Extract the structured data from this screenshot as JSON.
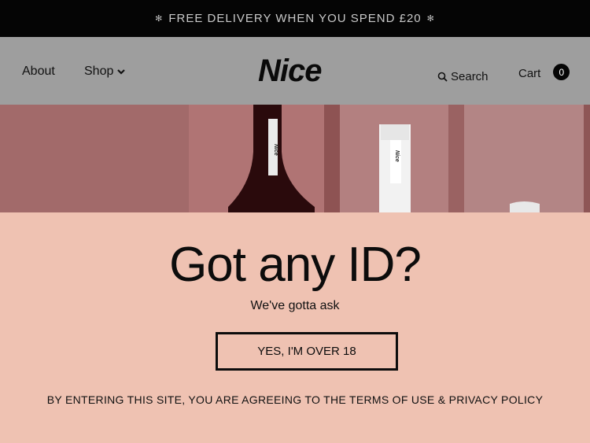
{
  "announcement": {
    "text": "FREE DELIVERY WHEN YOU SPEND £20",
    "star_left": "✻",
    "star_right": "✻"
  },
  "nav": {
    "about": "About",
    "shop": "Shop",
    "search": "Search",
    "cart": "Cart",
    "cart_count": "0"
  },
  "logo": {
    "text": "Nice",
    "bottle_label": "Nice"
  },
  "age_gate": {
    "title": "Got any ID?",
    "subtitle": "We've gotta ask",
    "confirm_button": "YES, I'M OVER 18",
    "terms": "BY ENTERING THIS SITE, YOU ARE AGREEING TO THE TERMS OF USE & PRIVACY POLICY"
  },
  "colors": {
    "announcement_bg": "#050505",
    "header_bg": "#9e9e9e",
    "hero_bg": "#a26a6a",
    "panel_bg": "#efc2b2",
    "text": "#0c0c0c"
  },
  "icons": {
    "announcement_left": "asterisk-icon",
    "announcement_right": "asterisk-icon",
    "shop": "chevron-down-icon",
    "search": "search-icon"
  }
}
